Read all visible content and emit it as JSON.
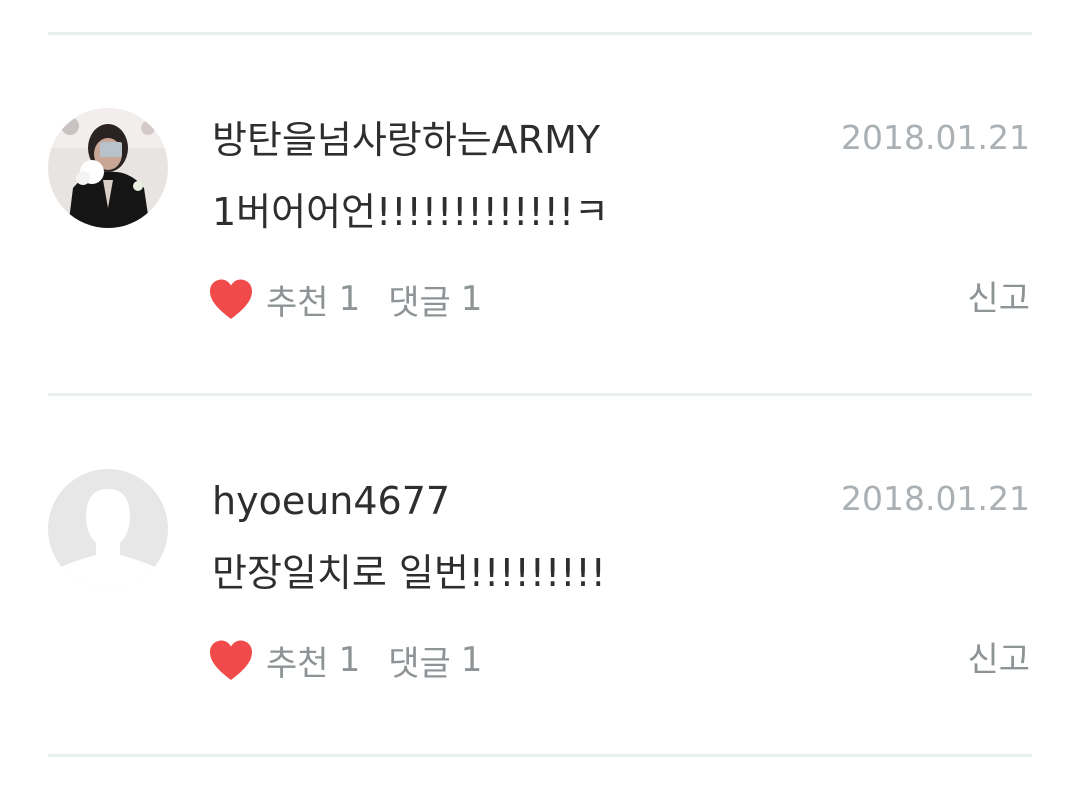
{
  "comments": [
    {
      "username": "방탄을넘사랑하는ARMY",
      "date": "2018.01.21",
      "text": "1버어어언!!!!!!!!!!!!!ㅋ",
      "recommend_label": "추천",
      "recommend_count": "1",
      "reply_label": "댓글",
      "reply_count": "1",
      "report_label": "신고",
      "avatar": "photo"
    },
    {
      "username": "hyoeun4677",
      "date": "2018.01.21",
      "text": "만장일치로 일번!!!!!!!!!",
      "recommend_label": "추천",
      "recommend_count": "1",
      "reply_label": "댓글",
      "reply_count": "1",
      "report_label": "신고",
      "avatar": "default-silhouette"
    }
  ],
  "colors": {
    "heart": "#f04a4a",
    "date": "#aab0b3",
    "action_text": "#8e9496",
    "divider": "#e9eeee",
    "text": "#2e2e2e"
  },
  "icons": {
    "like": "heart-icon",
    "avatar_default": "user-silhouette-icon"
  }
}
